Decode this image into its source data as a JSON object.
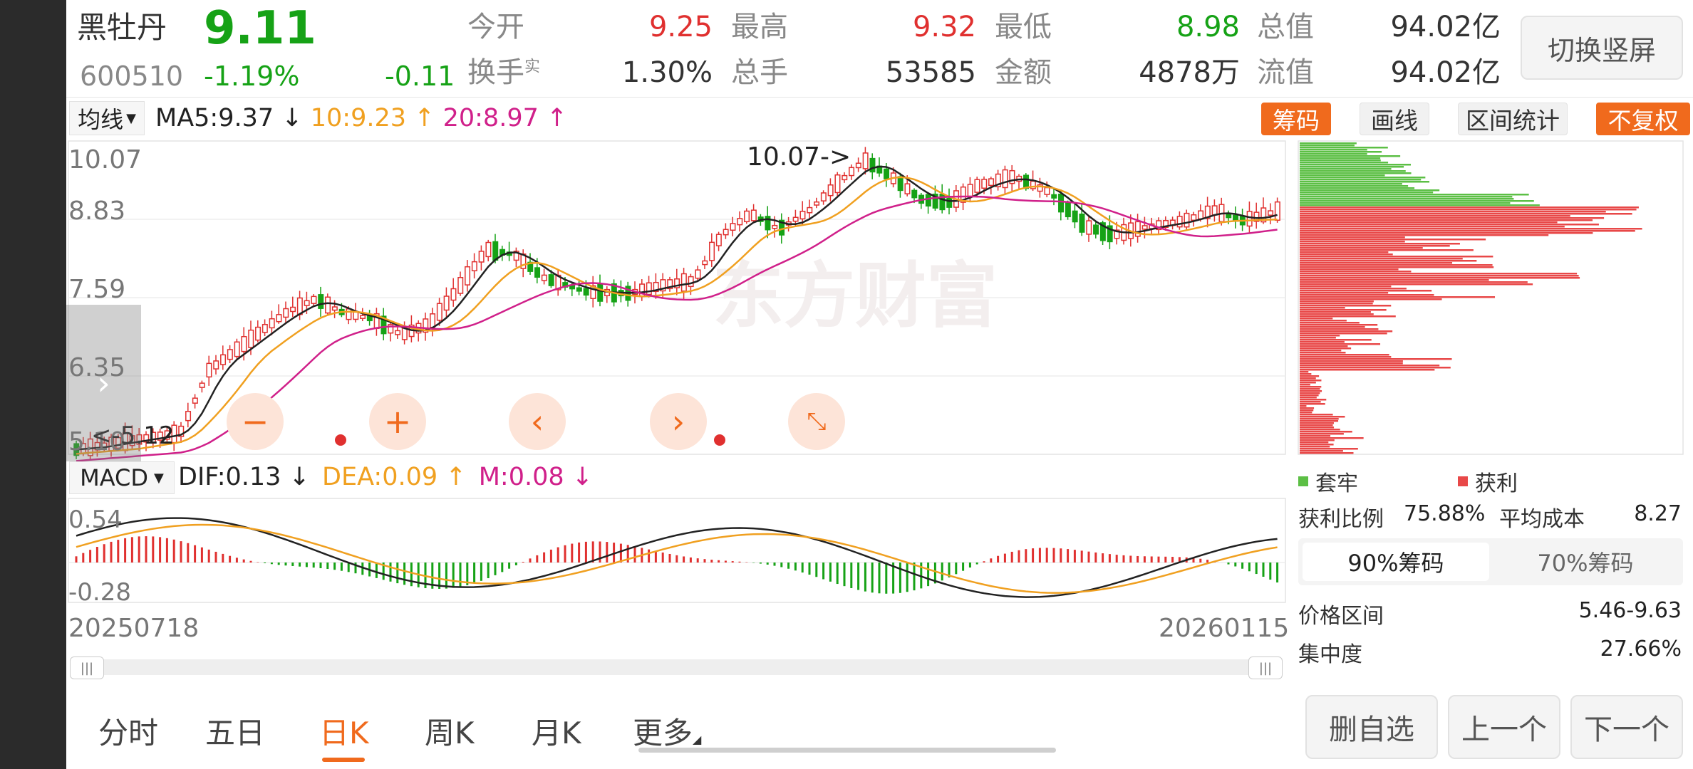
{
  "stock": {
    "name": "黑牡丹",
    "price": "9.11",
    "code": "600510",
    "change_pct": "-1.19%",
    "change": "-0.11"
  },
  "quote": {
    "open_label": "今开",
    "open": "9.25",
    "high_label": "最高",
    "high": "9.32",
    "low_label": "最低",
    "low": "8.98",
    "mcap_label": "总值",
    "mcap": "94.02亿",
    "turnover_label": "换手",
    "turnover_sup": "实",
    "turnover": "1.30%",
    "volume_label": "总手",
    "volume": "53585",
    "amount_label": "金额",
    "amount": "4878万",
    "float_label": "流值",
    "float_cap": "94.02亿"
  },
  "switch_button": "切换竖屏",
  "ma": {
    "type_label": "均线",
    "ma5": "MA5:9.37 ↓",
    "ma10": "10:9.23 ↑",
    "ma20": "20:8.97 ↑"
  },
  "tools": {
    "chips": "筹码",
    "draw": "画线",
    "range_stats": "区间统计",
    "no_adjust": "不复权"
  },
  "price_axis": [
    "10.07",
    "8.83",
    "7.59",
    "6.35",
    "5.10"
  ],
  "annotations": {
    "max_label": "10.07->",
    "min_label": "<-5.12"
  },
  "watermark": "东方财富",
  "macd": {
    "type_label": "MACD",
    "dif": "DIF:0.13 ↓",
    "dea": "DEA:0.09 ↑",
    "m": "M:0.08 ↓",
    "axis_top": "0.54",
    "axis_bottom": "-0.28"
  },
  "dates": {
    "start": "20250718",
    "end": "20260115"
  },
  "chip_panel": {
    "legend_trapped": "套牢",
    "legend_profit": "获利",
    "profit_ratio_label": "获利比例",
    "profit_ratio": "75.88%",
    "avg_cost_label": "平均成本",
    "avg_cost": "8.27",
    "tab_90": "90%筹码",
    "tab_70": "70%筹码",
    "price_range_label": "价格区间",
    "price_range": "5.46-9.63",
    "concentration_label": "集中度",
    "concentration": "27.66%"
  },
  "period_tabs": [
    "分时",
    "五日",
    "日K",
    "周K",
    "月K",
    "更多"
  ],
  "active_tab": "日K",
  "bottom_buttons": {
    "delete": "删自选",
    "prev": "上一个",
    "next": "下一个"
  },
  "colors": {
    "up": "#e0302f",
    "down": "#16a216",
    "ma5": "#222222",
    "ma10": "#f0a020",
    "ma20": "#d0208a",
    "accent": "#f06a1d",
    "chip_trapped": "#5cbf45",
    "chip_profit": "#e84848"
  }
}
